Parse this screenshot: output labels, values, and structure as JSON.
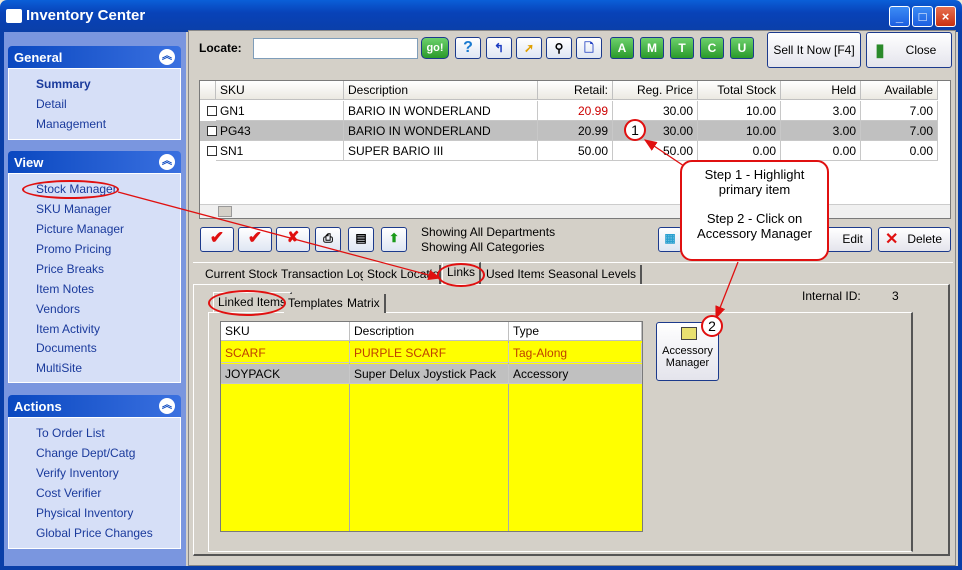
{
  "window": {
    "title": "Inventory Center",
    "controls": [
      "_",
      "□",
      "×"
    ]
  },
  "sidebar": {
    "general": {
      "title": "General",
      "items": [
        "Summary",
        "Detail",
        "Management"
      ]
    },
    "view": {
      "title": "View",
      "items": [
        "Stock Manager",
        "SKU Manager",
        "Picture Manager",
        "Promo Pricing",
        "Price Breaks",
        "Item Notes",
        "Vendors",
        "Item Activity",
        "Documents",
        "MultiSite"
      ]
    },
    "actions": {
      "title": "Actions",
      "items": [
        "To Order List",
        "Change Dept/Catg",
        "Verify Inventory",
        "Cost Verifier",
        "Physical Inventory",
        "Global Price Changes"
      ]
    }
  },
  "toolbar": {
    "locate_label": "Locate:",
    "locate_value": "",
    "go": "go!",
    "help": "?",
    "letters": [
      "A",
      "M",
      "T",
      "C",
      "U"
    ],
    "sell_now": "Sell It Now [F4]",
    "close": "Close"
  },
  "grid": {
    "columns": [
      "SKU",
      "Description",
      "Retail:",
      "Reg. Price",
      "Total Stock",
      "Held",
      "Available"
    ],
    "rows": [
      {
        "sku": "GN1",
        "description": "BARIO IN WONDERLAND",
        "retail": "20.99",
        "reg_price": "30.00",
        "total_stock": "10.00",
        "held": "3.00",
        "available": "7.00"
      },
      {
        "sku": "PG43",
        "description": "BARIO IN WONDERLAND",
        "retail": "20.99",
        "reg_price": "30.00",
        "total_stock": "10.00",
        "held": "3.00",
        "available": "7.00"
      },
      {
        "sku": "SN1",
        "description": "SUPER BARIO III",
        "retail": "50.00",
        "reg_price": "50.00",
        "total_stock": "0.00",
        "held": "0.00",
        "available": "0.00"
      }
    ]
  },
  "filter": {
    "departments": "Showing All Departments",
    "categories": "Showing All Categories"
  },
  "actions": {
    "edit": "Edit",
    "delete": "Delete"
  },
  "tabs": [
    "Current Stock",
    "Transaction Log",
    "Stock Location",
    "Links",
    "Used Items",
    "Seasonal Levels"
  ],
  "subtabs": [
    "Linked Items",
    "Templates",
    "Matrix"
  ],
  "links": {
    "columns": [
      "SKU",
      "Description",
      "Type"
    ],
    "rows": [
      {
        "sku": "SCARF",
        "description": "PURPLE SCARF",
        "type": "Tag-Along"
      },
      {
        "sku": "JOYPACK",
        "description": "Super Delux Joystick Pack",
        "type": "Accessory"
      }
    ],
    "accessory_manager": "Accessory Manager"
  },
  "internal_id": {
    "label": "Internal ID:",
    "value": "3"
  },
  "callout": {
    "step1": "Step 1 - Highlight primary item",
    "step2": "Step 2 - Click on Accessory Manager",
    "marker1": "1",
    "marker2": "2"
  },
  "colors": {
    "highlight_row": "#c0c0c0",
    "link_grid": "#ffff00",
    "annotation": "#e01010",
    "retail_red": "#cc0000"
  }
}
